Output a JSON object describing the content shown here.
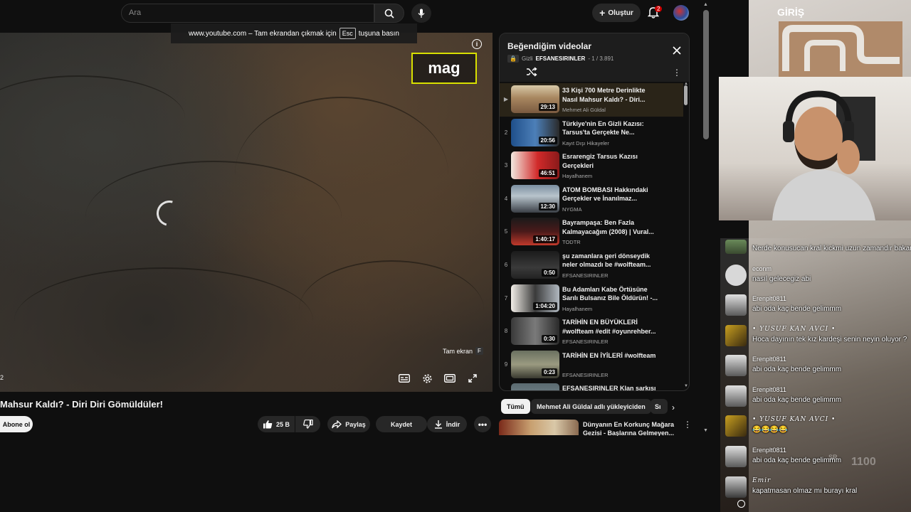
{
  "browser_tooltip": {
    "prefix": "www.youtube.com – Tam ekrandan çıkmak için",
    "key": "Esc",
    "suffix": "tuşuna basın"
  },
  "header": {
    "search_placeholder": "Ara",
    "create_label": "Oluştur",
    "notification_count": "2"
  },
  "player": {
    "overlay_text": "mag",
    "fullscreen_hint": "Tam ekran",
    "fullscreen_key": "F",
    "edge_text": "2"
  },
  "video": {
    "title": "Mahsur Kaldı? - Diri Diri Gömüldüler!",
    "subscribe_label": "Abone ol",
    "like_count": "25 B",
    "share_label": "Paylaş",
    "save_label": "Kaydet",
    "download_label": "İndir"
  },
  "playlist": {
    "title": "Beğendiğim videolar",
    "privacy": "Gizli",
    "owner": "EFSANESIRINLER",
    "position": "- 1 / 3.891",
    "items": [
      {
        "index": "▶",
        "title": "33 Kişi 700 Metre Derinlikte Nasıl Mahsur Kaldı? - Diri...",
        "channel": "Mehmet Ali Güldal",
        "duration": "29:13"
      },
      {
        "index": "2",
        "title": "Türkiye'nin En Gizli Kazısı: Tarsus'ta Gerçekte Ne...",
        "channel": "Kayıt Dışı Hikayeler",
        "duration": "20:56"
      },
      {
        "index": "3",
        "title": "Esrarengiz Tarsus Kazısı Gerçekleri",
        "channel": "Hayalhanem",
        "duration": "46:51"
      },
      {
        "index": "4",
        "title": "ATOM BOMBASI Hakkındaki Gerçekler ve İnanılmaz...",
        "channel": "NYGMA",
        "duration": "12:30"
      },
      {
        "index": "5",
        "title": "Bayrampaşa: Ben Fazla Kalmayacağım (2008) | Vural...",
        "channel": "TODTR",
        "duration": "1:40:17"
      },
      {
        "index": "6",
        "title": "şu zamanlara geri dönseydik neler olmazdı be #wolfteam...",
        "channel": "EFSANESIRINLER",
        "duration": "0:50"
      },
      {
        "index": "7",
        "title": "Bu Adamları Kabe Örtüsüne Sarılı Bulsanız Bile Öldürün! -...",
        "channel": "Hayalhanem",
        "duration": "1:04:20"
      },
      {
        "index": "8",
        "title": "TARİHİN EN BÜYÜKLERİ #wolfteam #edit #oyunrehber...",
        "channel": "EFSANESIRINLER",
        "duration": "0:30"
      },
      {
        "index": "9",
        "title": "TARİHİN EN İYİLERİ #wolfteam",
        "channel": "EFSANESIRINLER",
        "duration": "0:23"
      },
      {
        "index": "",
        "title": "EFSANESIRINLER Klan şarkısı",
        "channel": "",
        "duration": ""
      }
    ]
  },
  "chips": [
    "Tümü",
    "Mehmet Ali Güldal adlı yükleyiciden",
    "Sı"
  ],
  "recommended": {
    "title": "Dünyanın En Korkunç Mağara Gezisi - Başlarına Gelmeyen..."
  },
  "stream": {
    "corner_label": "GİRİŞ",
    "sr_label": "SR",
    "sr_value": "1100",
    "chat": [
      {
        "name": "",
        "text": "Nerde konusucan kral kickmi uzun zamandır bakamadım",
        "fancy": false
      },
      {
        "name": "econm",
        "text": "nasıl gelecegiz abi",
        "fancy": false
      },
      {
        "name": "Erenplt0811",
        "text": "abi oda kaç bende gelimmm",
        "fancy": false
      },
      {
        "name": "• YUSUF KAN AVCI •",
        "text": "Hoca dayının tek kız kardeşi senin neyin oluyor ?",
        "fancy": true
      },
      {
        "name": "Erenplt0811",
        "text": "abi oda kaç bende gelimmm",
        "fancy": false
      },
      {
        "name": "Erenplt0811",
        "text": "abi oda kaç bende gelimmm",
        "fancy": false
      },
      {
        "name": "• YUSUF KAN AVCI •",
        "text": "😂😂😂😂",
        "fancy": true
      },
      {
        "name": "Erenplt0811",
        "text": "abi oda kaç bende gelimmm",
        "fancy": false
      },
      {
        "name": "Emir",
        "text": "kapatmasan olmaz mı burayı kral",
        "fancy": true
      }
    ]
  },
  "colors": {
    "background": "#0f0f0f",
    "active_row": "#2a2418",
    "mag_border": "#d8e000",
    "badge": "#cc0000"
  }
}
